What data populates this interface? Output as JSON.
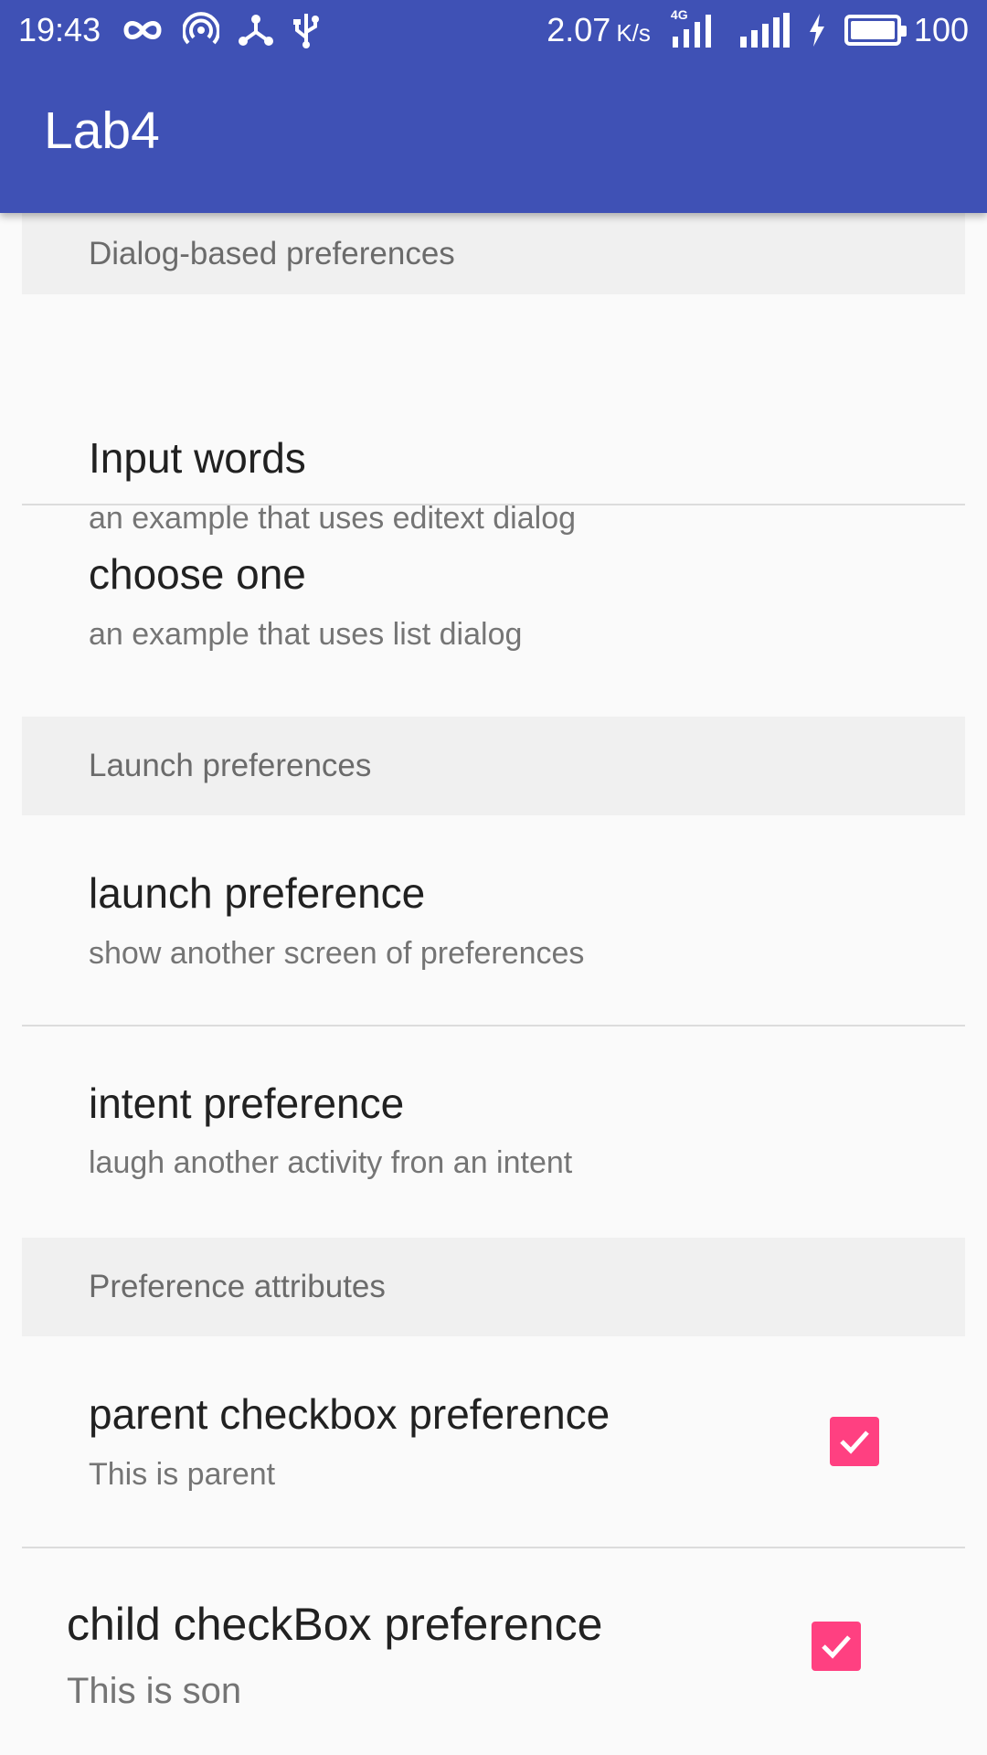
{
  "status_bar": {
    "time": "19:43",
    "speed_value": "2.07",
    "speed_unit": "K/s",
    "network_type": "4G",
    "battery_level": "100",
    "battery_fraction": 1.0,
    "icons": [
      "infinity-icon",
      "hotspot-icon",
      "share-icon",
      "usb-icon",
      "signal-4g-icon",
      "signal-icon",
      "charging-icon",
      "battery-icon"
    ]
  },
  "toolbar": {
    "title": "Lab4"
  },
  "preferences": {
    "cat_dialog": "Dialog-based preferences",
    "input_words": {
      "title": "Input words",
      "summary": "an example that uses editext dialog"
    },
    "choose_one": {
      "title": "choose one",
      "summary": "an example that uses list dialog"
    },
    "cat_launch": "Launch preferences",
    "launch_pref": {
      "title": "launch preference",
      "summary": "show another screen of preferences"
    },
    "intent_pref": {
      "title": "intent preference",
      "summary": "laugh another activity fron an intent"
    },
    "cat_attributes": "Preference attributes",
    "parent_checkbox": {
      "title": "parent checkbox preference",
      "summary": "This is parent",
      "checked": true
    },
    "child_checkbox": {
      "title": "child checkBox preference",
      "summary": "This is son",
      "checked": true
    }
  },
  "colors": {
    "primary": "#3f51b5",
    "accent": "#ff4081",
    "category_bg": "#f0f0f0",
    "background": "#fafafa"
  }
}
